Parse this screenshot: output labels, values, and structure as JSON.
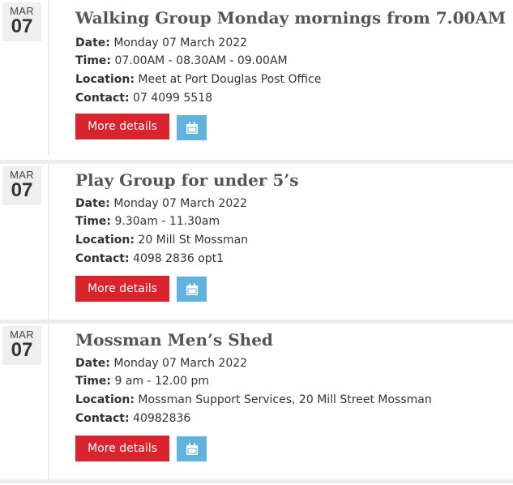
{
  "events": [
    {
      "month": "MAR",
      "day": "07",
      "title": "Walking Group Monday mornings from 7.00AM",
      "date_label": "Date:",
      "date": "Monday 07 March 2022",
      "time_label": "Time:",
      "time": "07.00AM - 08.30AM - 09.00AM",
      "location_label": "Location:",
      "location": "Meet at Port Douglas Post Office",
      "contact_label": "Contact:",
      "contact": "07 4099 5518",
      "more_label": "More details"
    },
    {
      "month": "MAR",
      "day": "07",
      "title": "Play Group for under 5’s",
      "date_label": "Date:",
      "date": "Monday 07 March 2022",
      "time_label": "Time:",
      "time": "9.30am - 11.30am",
      "location_label": "Location:",
      "location": "20 Mill St Mossman",
      "contact_label": "Contact:",
      "contact": "4098 2836 opt1",
      "more_label": "More details"
    },
    {
      "month": "MAR",
      "day": "07",
      "title": "Mossman Men’s Shed",
      "date_label": "Date:",
      "date": "Monday 07 March 2022",
      "time_label": "Time:",
      "time": "9 am - 12.00 pm",
      "location_label": "Location:",
      "location": "Mossman Support Services, 20 Mill Street Mossman",
      "contact_label": "Contact:",
      "contact": "40982836",
      "more_label": "More details"
    }
  ],
  "icons": {
    "calendar": "calendar-icon"
  },
  "colors": {
    "accent_red": "#d9232d",
    "calendar_blue": "#5fb3dc"
  }
}
